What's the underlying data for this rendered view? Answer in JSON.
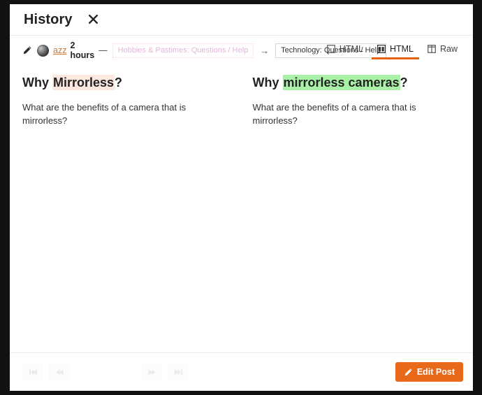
{
  "modal": {
    "title": "History",
    "close_icon": "close-icon"
  },
  "revision": {
    "edit_icon": "pencil-icon",
    "avatar": "user-avatar",
    "username": "azz",
    "time": "2 hours",
    "separator": "—",
    "category_old": "Hobbies & Pastimes: Questions / Help",
    "change_arrow": "→",
    "category_new": "Technology: Questions / Help"
  },
  "view_modes": [
    {
      "label": "HTML",
      "icon": "single-pane-icon",
      "active": false
    },
    {
      "label": "HTML",
      "icon": "split-pane-icon",
      "active": true
    },
    {
      "label": "Raw",
      "icon": "columns-icon",
      "active": false
    }
  ],
  "diff": {
    "left": {
      "title_prefix": "Why ",
      "title_changed": "Mirrorless",
      "title_suffix": "?",
      "body": "What are the benefits of a camera that is mirrorless?"
    },
    "right": {
      "title_prefix": "Why ",
      "title_changed": "mirrorless cameras",
      "title_suffix": "?",
      "body": "What are the benefits of a camera that is mirrorless?"
    }
  },
  "footer": {
    "nav": [
      {
        "name": "first-revision",
        "icon": "skip-to-start-icon"
      },
      {
        "name": "previous-revision",
        "icon": "rewind-icon"
      },
      {
        "name": "next-revision",
        "icon": "fast-forward-icon"
      },
      {
        "name": "last-revision",
        "icon": "skip-to-end-icon"
      }
    ],
    "edit_post_label": "Edit Post",
    "edit_post_icon": "pencil-icon"
  },
  "colors": {
    "accent": "#e9691b",
    "active_tab_underline": "#e4610a",
    "deletion_highlight": "#fde8e0",
    "insertion_highlight": "#aaf1a8",
    "username": "#c97b3e",
    "category_old": "#e3b7d8"
  }
}
